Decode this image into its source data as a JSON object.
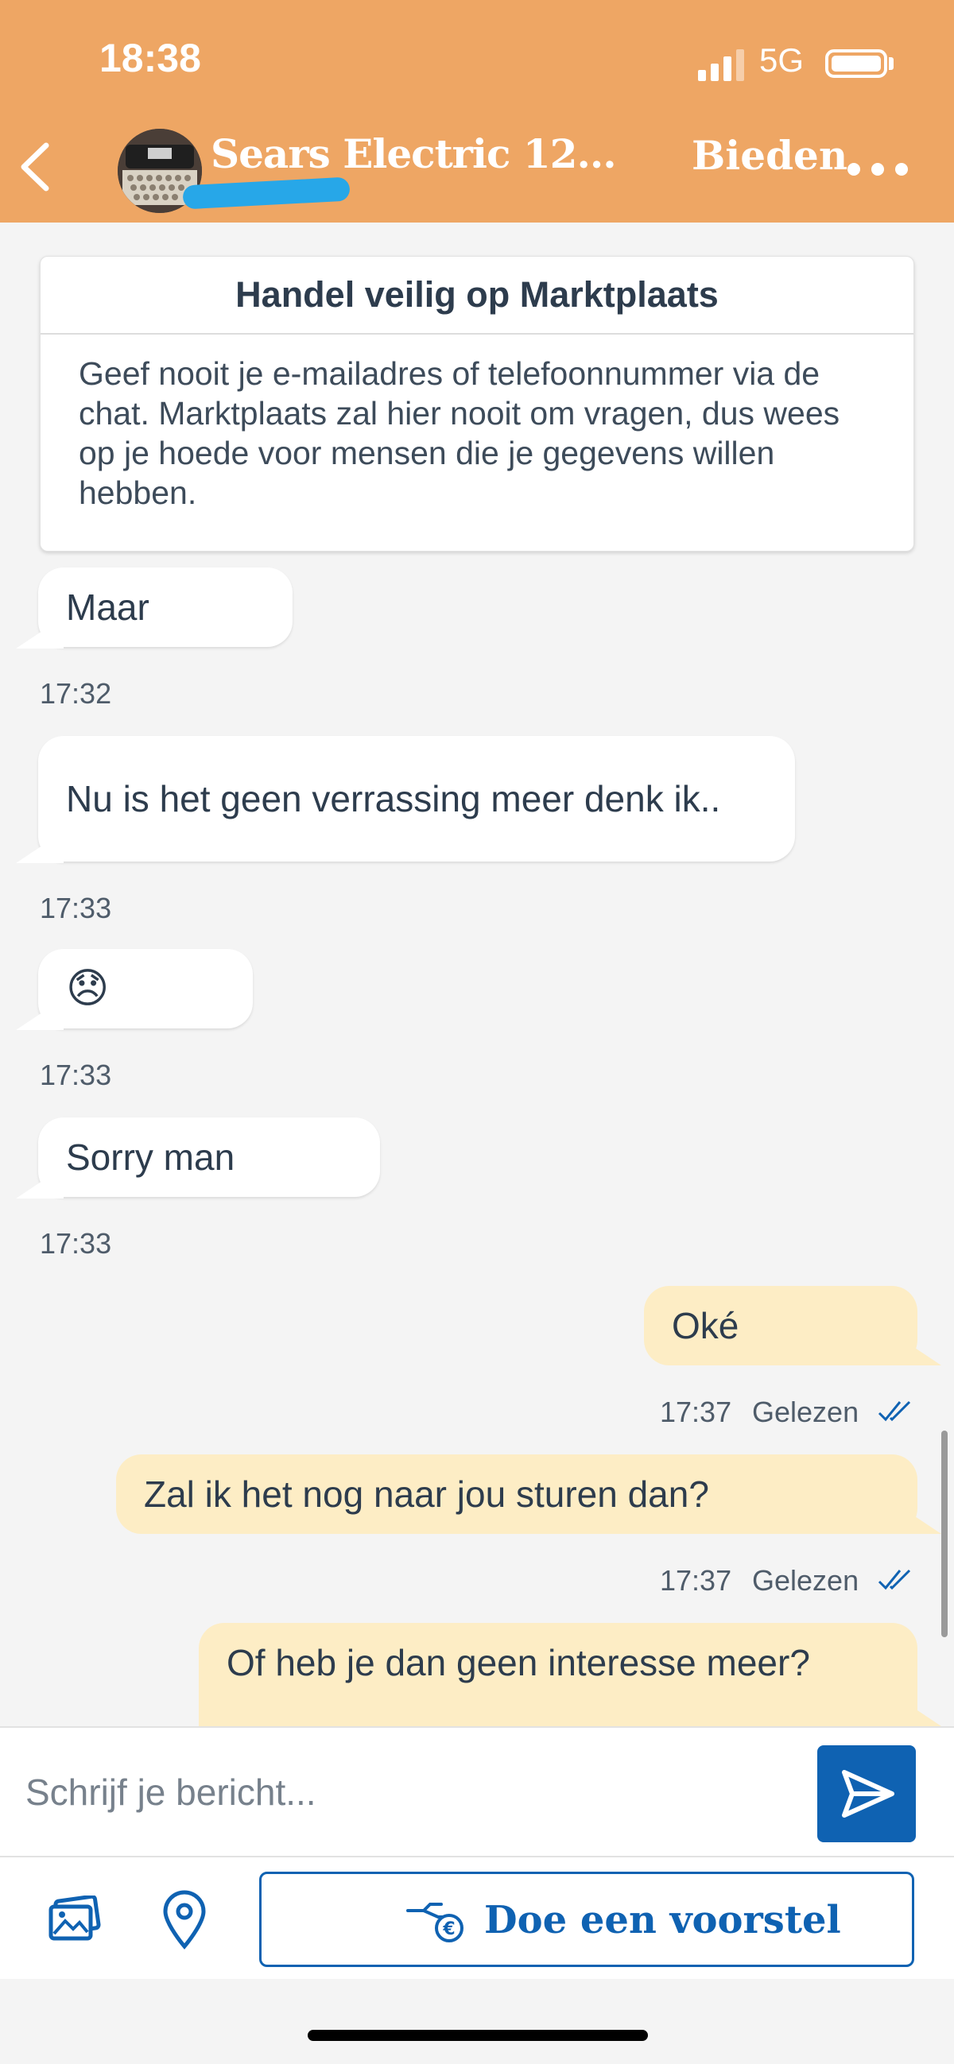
{
  "status_bar": {
    "time": "18:38",
    "network": "5G"
  },
  "header": {
    "title": "Sears Electric 12...",
    "offer_action": "Bieden"
  },
  "notice": {
    "title": "Handel veilig op Marktplaats",
    "body": "Geef nooit je e-mailadres of telefoonnummer via de chat. Marktplaats zal hier nooit om vragen, dus wees op je hoede voor mensen die je gegevens willen hebben."
  },
  "messages": [
    {
      "side": "in",
      "text": "Maar",
      "time": "17:32"
    },
    {
      "side": "in",
      "text": "Nu is het geen verrassing meer denk ik..",
      "time": "17:33"
    },
    {
      "side": "in",
      "text": "😞",
      "time": "17:33"
    },
    {
      "side": "in",
      "text": "Sorry man",
      "time": "17:33"
    },
    {
      "side": "out",
      "text": "Oké",
      "time": "17:37",
      "status": "Gelezen"
    },
    {
      "side": "out",
      "text": "Zal ik het nog naar jou sturen dan?",
      "time": "17:37",
      "status": "Gelezen"
    },
    {
      "side": "out",
      "text": "Of heb je dan geen interesse meer?"
    }
  ],
  "composer": {
    "placeholder": "Schrijf je bericht..."
  },
  "toolbar": {
    "offer_label": "Doe een voorstel"
  },
  "icons": [
    "back-chevron-icon",
    "more-dots-icon",
    "image-gallery-icon",
    "location-pin-icon",
    "send-icon",
    "hand-euro-icon"
  ],
  "colors": {
    "header": "#eea664",
    "accent": "#0f62b2",
    "outgoing_bubble": "#fdedc5",
    "background": "#f4f4f4"
  }
}
